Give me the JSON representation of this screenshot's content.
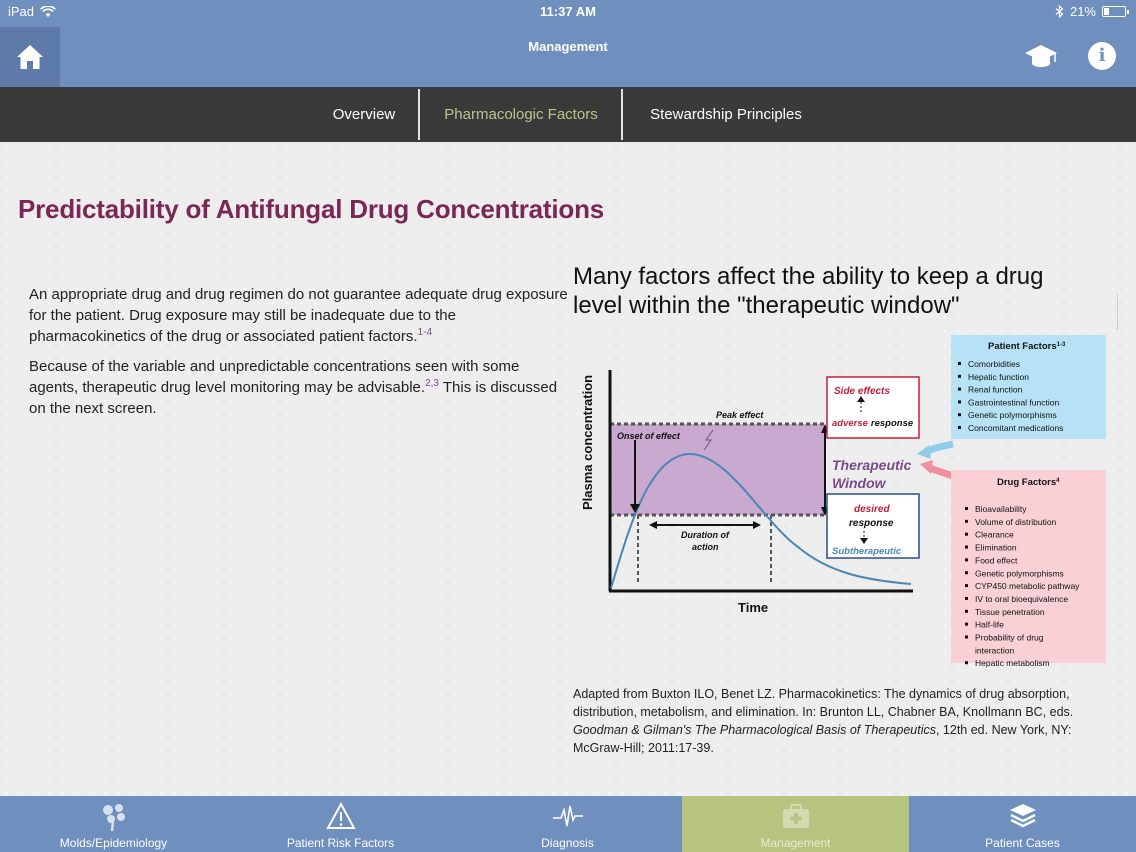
{
  "status_bar": {
    "device": "iPad",
    "time": "11:37 AM",
    "battery": "21%",
    "battery_level": 0.21
  },
  "nav": {
    "title": "Management"
  },
  "tabs": [
    {
      "label": "Overview",
      "active": false
    },
    {
      "label": "Pharmacologic Factors",
      "active": true
    },
    {
      "label": "Stewardship Principles",
      "active": false
    }
  ],
  "content": {
    "title": "Predictability of Antifungal Drug Concentrations",
    "para1": "An appropriate drug and drug regimen do not guarantee adequate drug exposure for the patient. Drug exposure may still be inadequate due to the pharmacokinetics of the drug or associated patient factors.",
    "para1_ref": "1-4",
    "para2": "Because of the variable and unpredictable concentrations seen with some agents, therapeutic drug level monitoring may be advisable.",
    "para2_ref": "2,3",
    "para2_tail": " This is discussed on the next screen.",
    "right_heading": "Many factors affect the ability to keep a drug level within the \"therapeutic window\""
  },
  "figure": {
    "y_axis_label": "Plasma concentration",
    "x_axis_label": "Time",
    "peak_effect": "Peak effect",
    "onset_of_effect": "Onset of effect",
    "duration_line1": "Duration of",
    "duration_line2": "action",
    "side_effects": "Side effects",
    "adverse": "adverse",
    "response": "response",
    "therapeutic": "Therapeutic",
    "window": "Window",
    "desired": "desired",
    "desired_response": "response",
    "subtherapeutic": "Subtherapeutic",
    "patient_factors_title": "Patient Factors",
    "patient_factors_ref": "1-3",
    "patient_factors": [
      "Comorbidities",
      "Hepatic function",
      "Renal function",
      "Gastrointestinal function",
      "Genetic polymorphisms",
      "Concomitant medications"
    ],
    "drug_factors_title": "Drug Factors",
    "drug_factors_ref": "4",
    "drug_factors": [
      "Bioavailability",
      "Volume of distribution",
      "Clearance",
      "Elimination",
      "Food effect",
      "Genetic polymorphisms",
      "CYP450 metabolic pathway",
      "IV to oral bioequivalence",
      "Tissue penetration",
      "Half-life",
      "Probability of drug",
      "interaction",
      "Hepatic metabolism"
    ]
  },
  "caption": {
    "part1": "Adapted from Buxton ILO, Benet LZ. Pharmacokinetics: The dynamics of drug absorption, distribution, metabolism, and elimination. In: Brunton LL, Chabner BA, Knollmann BC, eds. ",
    "italic": "Goodman & Gilman's The Pharmacological Basis of Therapeutics",
    "part2": ", 12th ed. New York, NY: McGraw-Hill; 2011:17-39."
  },
  "bottom_tabs": [
    {
      "label": "Molds/Epidemiology",
      "icon": "molds-icon",
      "active": false
    },
    {
      "label": "Patient Risk Factors",
      "icon": "warning-icon",
      "active": false
    },
    {
      "label": "Diagnosis",
      "icon": "pulse-icon",
      "active": false
    },
    {
      "label": "Management",
      "icon": "medical-kit-icon",
      "active": true
    },
    {
      "label": "Patient Cases",
      "icon": "layers-icon",
      "active": false
    }
  ],
  "colors": {
    "nav_blue": "#6f8fbf",
    "tab_active": "#b9c48a",
    "title_maroon": "#7a2753",
    "window_purple": "#c9a9cf",
    "patient_box": "#b7e1f5",
    "drug_box": "#f8d0d6"
  }
}
